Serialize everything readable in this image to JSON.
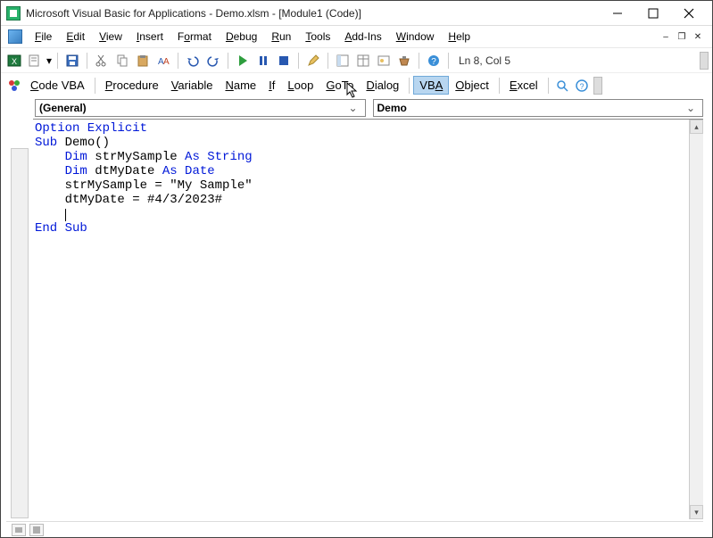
{
  "title": "Microsoft Visual Basic for Applications - Demo.xlsm - [Module1 (Code)]",
  "menubar": {
    "file": "File",
    "edit": "Edit",
    "view": "View",
    "insert": "Insert",
    "format": "Format",
    "debug": "Debug",
    "run": "Run",
    "tools": "Tools",
    "addins": "Add-Ins",
    "window": "Window",
    "help": "Help"
  },
  "status": "Ln 8, Col 5",
  "toolbar2": {
    "codevba": "Code VBA",
    "procedure": "Procedure",
    "variable": "Variable",
    "name": "Name",
    "if": "If",
    "loop": "Loop",
    "goto": "GoTo",
    "dialog": "Dialog",
    "vba": "VBA",
    "object": "Object",
    "excel": "Excel"
  },
  "combo1": "(General)",
  "combo2": "Demo",
  "code": {
    "l1": "Option Explicit",
    "l2": "",
    "l3a": "Sub",
    "l3b": " Demo()",
    "l4a": "    ",
    "l4b": "Dim",
    "l4c": " strMySample ",
    "l4d": "As String",
    "l5a": "    ",
    "l5b": "Dim",
    "l5c": " dtMyDate ",
    "l5d": "As Date",
    "l6": "    strMySample = \"My Sample\"",
    "l7": "    dtMyDate = #4/3/2023#",
    "l8": "    ",
    "l9": "End Sub"
  }
}
